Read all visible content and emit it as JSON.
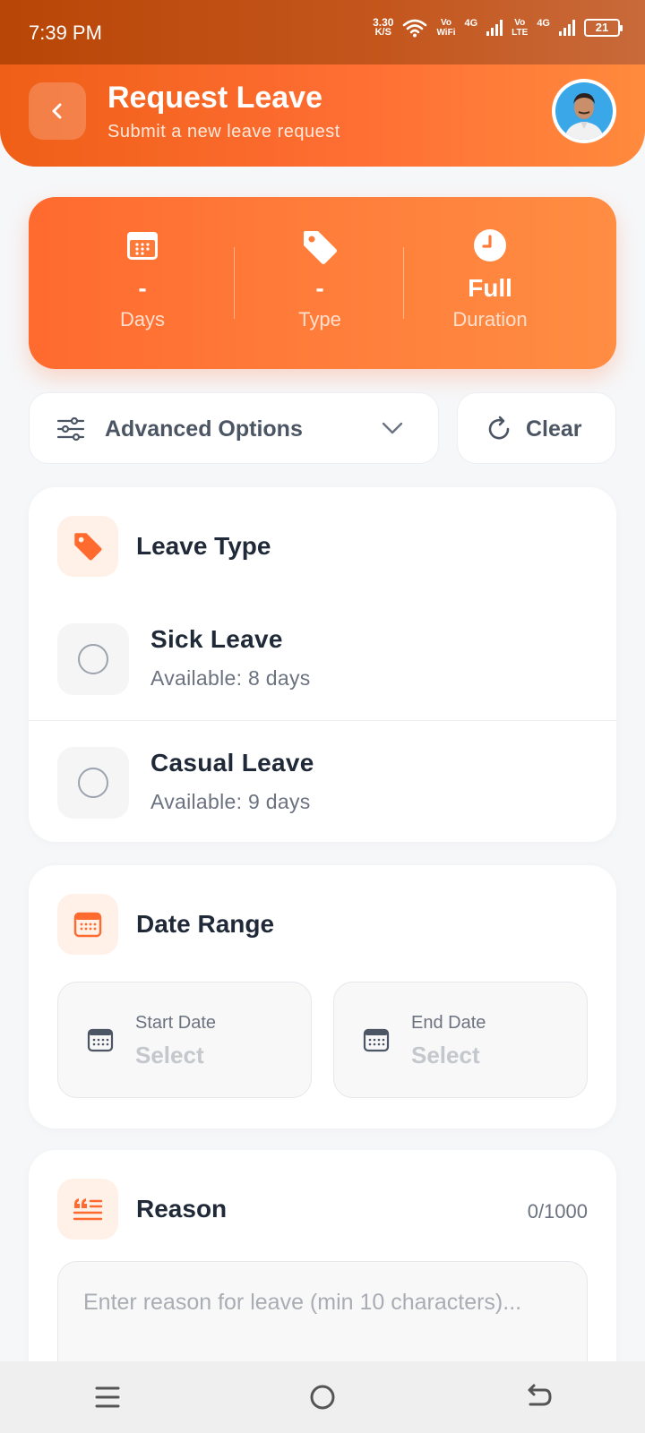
{
  "status_bar": {
    "time": "7:39 PM",
    "speed_value": "3.30",
    "speed_unit": "K/S",
    "vowifi_top": "Vo",
    "vowifi_bottom": "WiFi",
    "net1": "4G",
    "volte_top": "Vo",
    "volte_bottom": "LTE",
    "net2": "4G",
    "battery": "21"
  },
  "header": {
    "title": "Request Leave",
    "subtitle": "Submit a new leave request",
    "back_icon": "chevron-left-icon",
    "avatar": "user-avatar"
  },
  "summary": {
    "days_value": "-",
    "days_label": "Days",
    "type_value": "-",
    "type_label": "Type",
    "duration_value": "Full",
    "duration_label": "Duration"
  },
  "options": {
    "advanced_label": "Advanced Options",
    "clear_label": "Clear"
  },
  "leave_type": {
    "title": "Leave Type",
    "items": [
      {
        "title": "Sick Leave",
        "available": "Available: 8 days",
        "selected": false
      },
      {
        "title": "Casual Leave",
        "available": "Available: 9 days",
        "selected": false
      }
    ]
  },
  "date_range": {
    "title": "Date Range",
    "start_label": "Start Date",
    "start_value": "Select",
    "end_label": "End Date",
    "end_value": "Select"
  },
  "reason": {
    "title": "Reason",
    "count": "0/1000",
    "placeholder": "Enter reason for leave (min 10 characters)..."
  },
  "colors": {
    "accent": "#ff6e33",
    "accent_dark": "#ef5f17",
    "icon_bg": "#fff0e8"
  }
}
